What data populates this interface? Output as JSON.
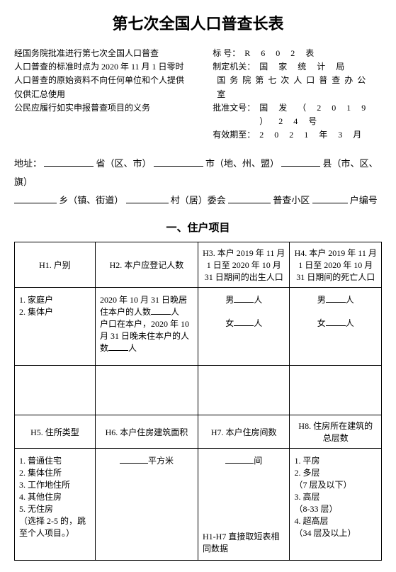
{
  "title": "第七次全国人口普查长表",
  "header_left": [
    "经国务院批准进行第七次全国人口普查",
    "人口普查的标准时点为 2020 年 11 月 1 日零时",
    "人口普查的原始资料不向任何单位和个人提供",
    "仅供汇总使用",
    "公民应履行如实申报普查项目的义务"
  ],
  "header_right": [
    {
      "label": "标    号：",
      "value": "R   6   0   2   表"
    },
    {
      "label": "制定机关：",
      "value": "国  家  统  计  局"
    },
    {
      "label": "",
      "value": "国务院第七次人口普查办公室"
    },
    {
      "label": "批准文号：",
      "value": "国 发 （ 2 0 1 9 ） 2 4 号"
    },
    {
      "label": "有效期至：",
      "value": "2  0  2  1  年  3  月"
    }
  ],
  "addr": {
    "l1a": "地址：",
    "l1b": "省（区、市）",
    "l1c": "市（地、州、盟）",
    "l1d": "县（市、区、旗）",
    "l2a": "乡（镇、街道）",
    "l2b": "村（居）委会",
    "l2c": "普查小区",
    "l2d": "户编号"
  },
  "section1_title": "一、住户项目",
  "t1": {
    "h1": "H1. 户别",
    "h2": "H2. 本户应登记人数",
    "h3": "H3. 本户 2019 年 11 月 1 日至 2020 年 10 月 31 日期间的出生人口",
    "h4": "H4. 本户 2019 年 11 月 1 日至 2020 年 10 月 31 日期间的死亡人口",
    "c1_1": "1. 家庭户",
    "c1_2": "2. 集体户",
    "c2_a": "2020 年 10 月 31 日晚居住本户的人数",
    "c2_b": "人",
    "c2_c": "户口在本户，2020 年 10 月 31 日晚未住本户的人数",
    "c2_d": "人",
    "male": "男",
    "female": "女",
    "unit_person": "人"
  },
  "t2": {
    "h5": "H5. 住所类型",
    "h6": "H6. 本户住房建筑面积",
    "h7": "H7. 本户住房间数",
    "h8": "H8. 住房所在建筑的总层数",
    "c5_1": "1. 普通住宅",
    "c5_2": "2. 集体住所",
    "c5_3": "3. 工作地住所",
    "c5_4": "4. 其他住房",
    "c5_5": "5. 无住房",
    "c5_note": "（选择 2-5 的，跳至个人项目。）",
    "c6_unit": "平方米",
    "c7_unit": "间",
    "c7_note": "H1-H7 直接取短表相同数据",
    "c8_1": "1. 平房",
    "c8_2": "2. 多层",
    "c8_2n": "（7 层及以下）",
    "c8_3": "3. 高层",
    "c8_3n": "（8-33 层）",
    "c8_4": "4. 超高层",
    "c8_4n": "（34 层及以上）"
  }
}
